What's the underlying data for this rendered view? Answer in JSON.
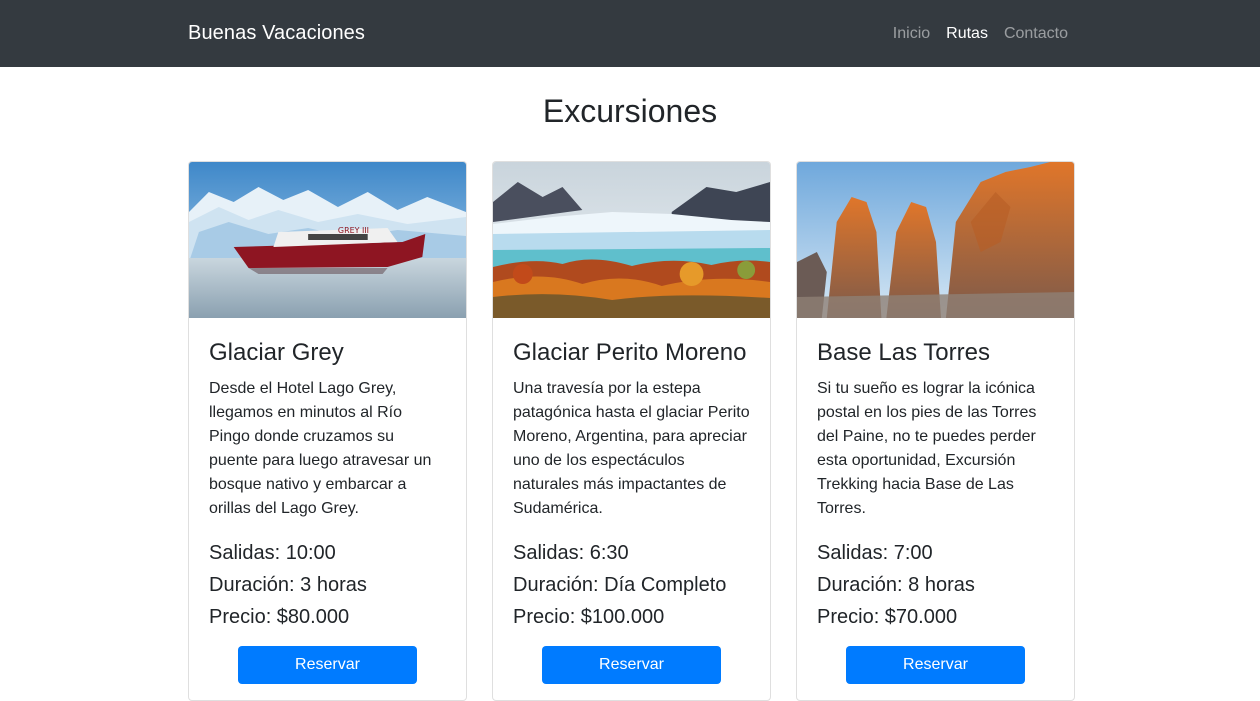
{
  "navbar": {
    "brand": "Buenas Vacaciones",
    "links": [
      {
        "label": "Inicio"
      },
      {
        "label": "Rutas"
      },
      {
        "label": "Contacto"
      }
    ]
  },
  "page_title": "Excursiones",
  "cards": [
    {
      "title": "Glaciar Grey",
      "description": "Desde el Hotel Lago Grey, llegamos en minutos al Río Pingo donde cruzamos su puente para luego atravesar un bosque nativo y embarcar a orillas del Lago Grey.",
      "salidas": "Salidas: 10:00",
      "duracion": "Duración: 3 horas",
      "precio": "Precio: $80.000",
      "button": "Reservar",
      "boat_label": "GREY III"
    },
    {
      "title": "Glaciar Perito Moreno",
      "description": "Una travesía por la estepa patagónica hasta el glaciar Perito Moreno, Argentina, para apreciar uno de los espectáculos naturales más impactantes de Sudamérica.",
      "salidas": "Salidas: 6:30",
      "duracion": "Duración: Día Completo",
      "precio": "Precio: $100.000",
      "button": "Reservar"
    },
    {
      "title": "Base Las Torres",
      "description": "Si tu sueño es lograr la icónica postal en los pies de las Torres del Paine, no te puedes perder esta oportunidad, Excursión Trekking hacia Base de Las Torres.",
      "salidas": "Salidas: 7:00",
      "duracion": "Duración: 8 horas",
      "precio": "Precio: $70.000",
      "button": "Reservar"
    }
  ],
  "colors": {
    "navbar_bg": "#343a40",
    "primary": "#007bff"
  }
}
